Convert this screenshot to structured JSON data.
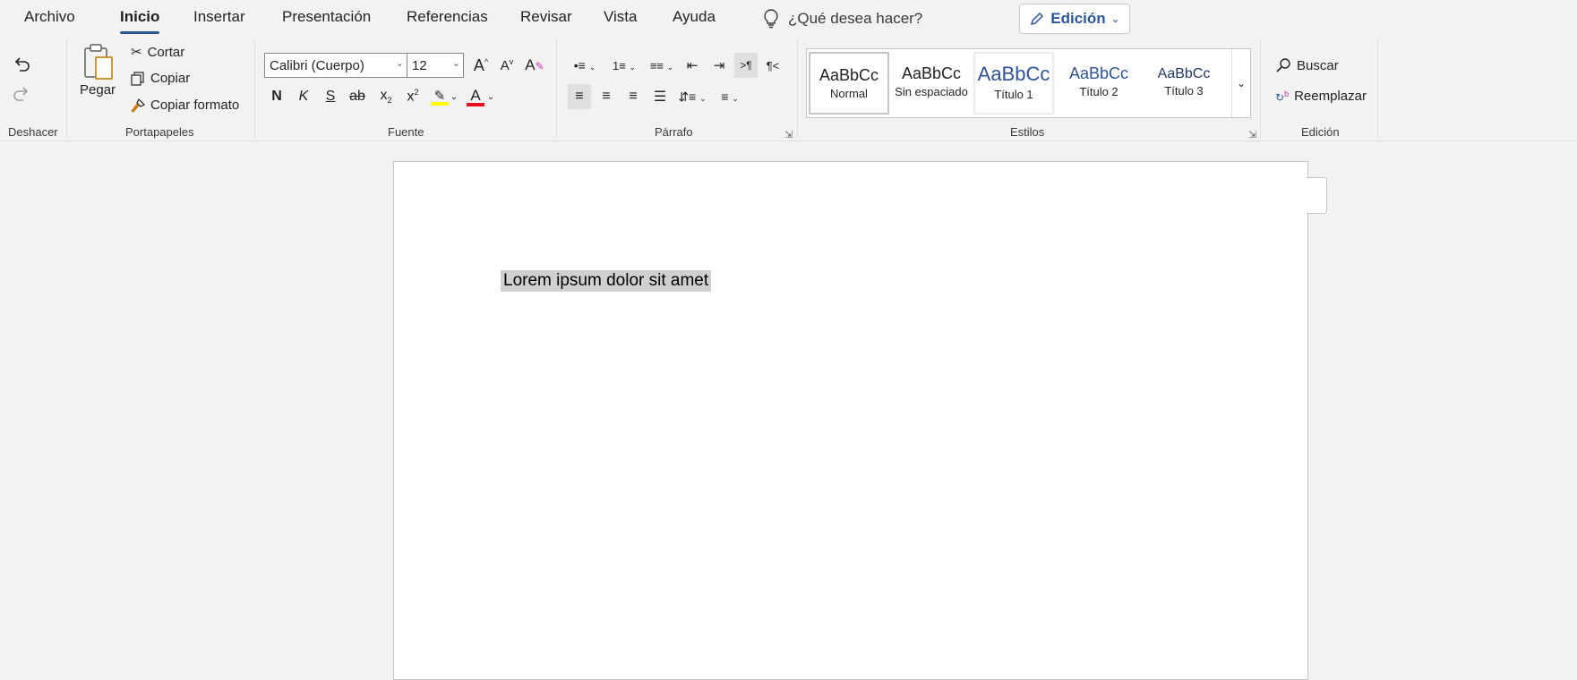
{
  "menu": {
    "tabs": [
      "Archivo",
      "Inicio",
      "Insertar",
      "Presentación",
      "Referencias",
      "Revisar",
      "Vista",
      "Ayuda"
    ],
    "active_tab": "Inicio",
    "tell_me": "¿Qué desea hacer?",
    "mode_button": "Edición"
  },
  "ribbon": {
    "undo": {
      "label": "Deshacer"
    },
    "clipboard": {
      "label": "Portapapeles",
      "paste": "Pegar",
      "cut": "Cortar",
      "copy": "Copiar",
      "format_painter": "Copiar formato"
    },
    "font": {
      "label": "Fuente",
      "font_name": "Calibri (Cuerpo)",
      "font_size": "12",
      "bold": "N",
      "italic": "K",
      "underline": "S",
      "strike": "ab",
      "highlight_color": "#ffff00",
      "font_color": "#e81123"
    },
    "paragraph": {
      "label": "Párrafo"
    },
    "styles": {
      "label": "Estilos",
      "items": [
        {
          "sample": "AaBbCc",
          "name": "Normal",
          "color": "#000000"
        },
        {
          "sample": "AaBbCc",
          "name": "Sin espaciado",
          "color": "#000000"
        },
        {
          "sample": "AaBbCc",
          "name": "Título 1",
          "color": "#2f5496"
        },
        {
          "sample": "AaBbCc",
          "name": "Título 2",
          "color": "#2f5496"
        },
        {
          "sample": "AaBbCc",
          "name": "Título 3",
          "color": "#1f3864"
        }
      ]
    },
    "editing": {
      "label": "Edición",
      "find": "Buscar",
      "replace": "Reemplazar"
    }
  },
  "document": {
    "selected_text": "Lorem ipsum dolor sit amet"
  },
  "colors": {
    "accent": "#2b579a",
    "ribbon_bg": "#f3f2f1",
    "page_bg": "#ffffff"
  }
}
